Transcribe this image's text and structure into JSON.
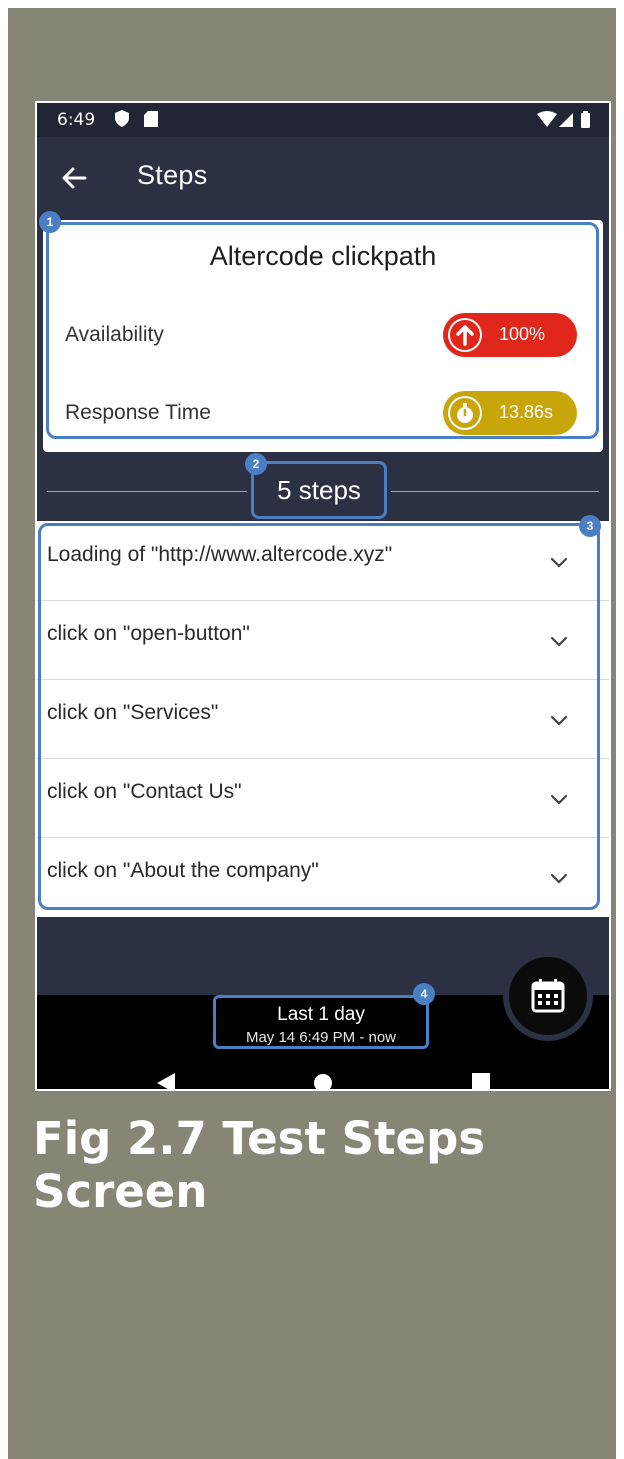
{
  "status": {
    "time": "6:49"
  },
  "appbar": {
    "title": "Steps"
  },
  "summary": {
    "title": "Altercode clickpath",
    "availability": {
      "label": "Availability",
      "value": "100%"
    },
    "response_time": {
      "label": "Response Time",
      "value": "13.86s"
    }
  },
  "steps_count": "5 steps",
  "steps": [
    "Loading of \"http://www.altercode.xyz\"",
    "click on \"open-button\"",
    "click on \"Services\"",
    "click on \"Contact Us\"",
    "click on \"About the company\""
  ],
  "time_range": {
    "title": "Last 1 day",
    "subtitle": "May 14 6:49 PM - now"
  },
  "callouts": [
    "1",
    "2",
    "3",
    "4"
  ],
  "caption": "Fig 2.7 Test Steps Screen",
  "colors": {
    "availability": "#e1261c",
    "response_time": "#c9a50c",
    "highlight": "#4a7fc4",
    "header": "#2b3043"
  },
  "icons": [
    "back-arrow-icon",
    "arrow-up-icon",
    "stopwatch-icon",
    "chevron-down-icon",
    "calendar-icon"
  ]
}
